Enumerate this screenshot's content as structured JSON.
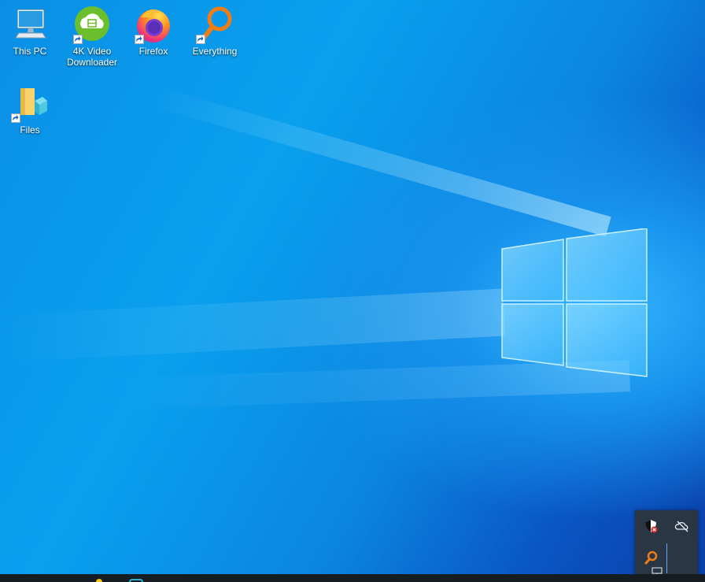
{
  "desktop": {
    "icons": [
      {
        "label": "This PC",
        "icon": "computer-icon"
      },
      {
        "label": "4K Video Downloader",
        "line1": "4K Video",
        "line2": "Downloader",
        "icon": "video-downloader-icon"
      },
      {
        "label": "Firefox",
        "icon": "firefox-icon"
      },
      {
        "label": "Everything",
        "icon": "everything-search-icon"
      },
      {
        "label": "Files",
        "icon": "files-folder-icon"
      }
    ]
  },
  "tray_overflow": {
    "items": [
      "security-shield-icon",
      "onedrive-offline-icon",
      "everything-tray-icon",
      "network-icon"
    ]
  },
  "colors": {
    "wallpaper": "#0a8fe6",
    "taskbar": "#151d22",
    "tray_popup": "#2b3645",
    "everything_orange": "#f07d12"
  }
}
